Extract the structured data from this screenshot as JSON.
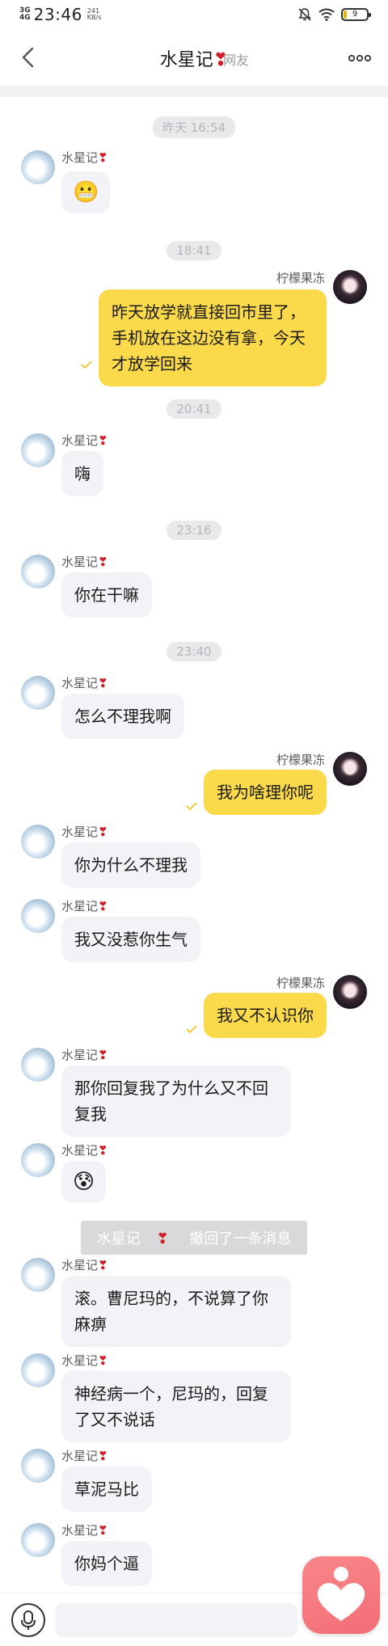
{
  "status_bar": {
    "network": "3G",
    "network2": "4G",
    "time": "23:46",
    "speed_value": "241",
    "speed_unit": "KB/s",
    "battery": "9"
  },
  "nav": {
    "title": "水星记",
    "title_heart": "❣",
    "subtitle": "网友"
  },
  "contact": {
    "left_name": "水星记",
    "right_name": "柠檬果冻",
    "heart": "❣"
  },
  "messages": {
    "ts1": "昨天 16:54",
    "emoji1": "😬",
    "ts2": "18:41",
    "out1": "昨天放学就直接回市里了，手机放在这边没有拿，今天才放学回来",
    "ts3": "20:41",
    "in2": "嗨",
    "ts4": "23:16",
    "in3": "你在干嘛",
    "ts5": "23:40",
    "in4": "怎么不理我啊",
    "out2": "我为啥理你呢",
    "in5": "你为什么不理我",
    "in6": "我又没惹你生气",
    "out3": "我又不认识你",
    "in7": "那你回复我了为什么又不回复我",
    "emoji2": "😰",
    "recall_name": "水星记",
    "recall_text": "撤回了一条消息",
    "in8": "滚。曹尼玛的，不说算了你麻痹",
    "in9": "神经病一个，尼玛的，回复了又不说话",
    "in10": "草泥马比",
    "in11": "你妈个逼"
  },
  "colors": {
    "outgoing_bubble": "#fad94a",
    "incoming_bubble": "#f2f3f6",
    "heart": "#d0202a",
    "fab": "#f26d75"
  },
  "icons": {
    "back": "chevron-left-icon",
    "more": "more-dots-icon",
    "mic": "microphone-icon",
    "fab": "heart-icon"
  }
}
